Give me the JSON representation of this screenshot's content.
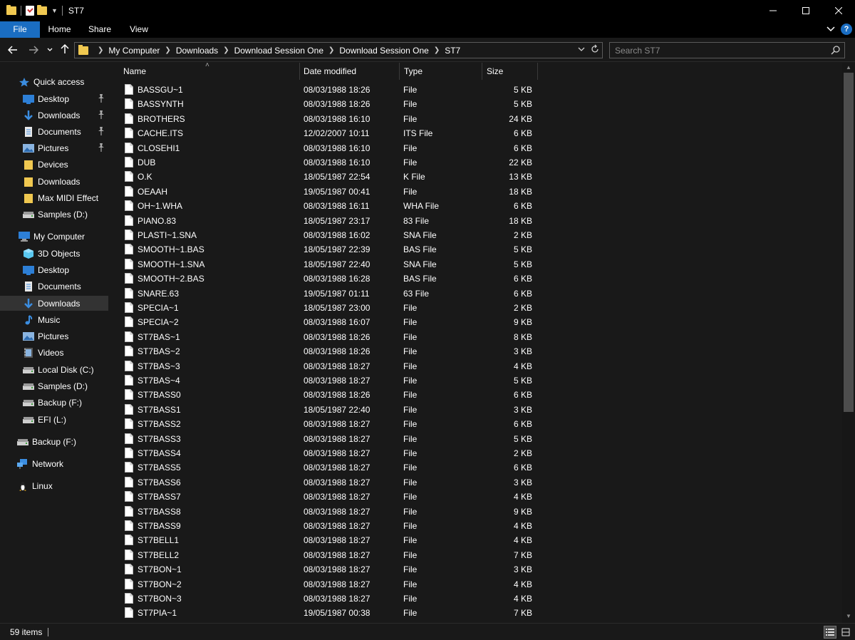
{
  "window": {
    "title": "ST7",
    "minimize_icon": "minimize-icon",
    "maximize_icon": "maximize-icon",
    "close_icon": "close-icon"
  },
  "ribbon": {
    "tabs": [
      {
        "label": "File"
      },
      {
        "label": "Home"
      },
      {
        "label": "Share"
      },
      {
        "label": "View"
      }
    ],
    "help_label": "?"
  },
  "address": {
    "breadcrumbs": [
      "My Computer",
      "Downloads",
      "Download Session One",
      "Download Session One",
      "ST7"
    ]
  },
  "search": {
    "placeholder": "Search ST7"
  },
  "sidebar": {
    "items": [
      {
        "label": "Quick access",
        "icon": "star-icon",
        "pinned": false
      },
      {
        "label": "Desktop",
        "icon": "desktop-icon",
        "pinned": true
      },
      {
        "label": "Downloads",
        "icon": "download-arrow-icon",
        "pinned": true
      },
      {
        "label": "Documents",
        "icon": "documents-icon",
        "pinned": true
      },
      {
        "label": "Pictures",
        "icon": "pictures-icon",
        "pinned": true
      },
      {
        "label": "Devices",
        "icon": "folder-icon",
        "pinned": false
      },
      {
        "label": "Downloads",
        "icon": "folder-icon",
        "pinned": false
      },
      {
        "label": "Max MIDI Effect",
        "icon": "folder-icon",
        "pinned": false
      },
      {
        "label": "Samples (D:)",
        "icon": "drive-icon",
        "pinned": false
      },
      {
        "label": "My Computer",
        "icon": "computer-icon",
        "pinned": false
      },
      {
        "label": "3D Objects",
        "icon": "3d-objects-icon",
        "pinned": false
      },
      {
        "label": "Desktop",
        "icon": "desktop-icon",
        "pinned": false
      },
      {
        "label": "Documents",
        "icon": "documents-icon",
        "pinned": false
      },
      {
        "label": "Downloads",
        "icon": "download-arrow-icon",
        "pinned": false,
        "selected": true
      },
      {
        "label": "Music",
        "icon": "music-icon",
        "pinned": false
      },
      {
        "label": "Pictures",
        "icon": "pictures-icon",
        "pinned": false
      },
      {
        "label": "Videos",
        "icon": "videos-icon",
        "pinned": false
      },
      {
        "label": "Local Disk (C:)",
        "icon": "drive-icon",
        "pinned": false
      },
      {
        "label": "Samples (D:)",
        "icon": "drive-icon",
        "pinned": false
      },
      {
        "label": "Backup (F:)",
        "icon": "drive-icon",
        "pinned": false
      },
      {
        "label": "EFI (L:)",
        "icon": "drive-icon",
        "pinned": false
      },
      {
        "label": "Backup (F:)",
        "icon": "drive-icon",
        "pinned": false
      },
      {
        "label": "Network",
        "icon": "network-icon",
        "pinned": false
      },
      {
        "label": "Linux",
        "icon": "linux-icon",
        "pinned": false
      }
    ]
  },
  "columns": {
    "name": "Name",
    "date": "Date modified",
    "type": "Type",
    "size": "Size"
  },
  "files": [
    {
      "name": "BASSGU~1",
      "date": "08/03/1988 18:26",
      "type": "File",
      "size": "5 KB"
    },
    {
      "name": "BASSYNTH",
      "date": "08/03/1988 18:26",
      "type": "File",
      "size": "5 KB"
    },
    {
      "name": "BROTHERS",
      "date": "08/03/1988 16:10",
      "type": "File",
      "size": "24 KB"
    },
    {
      "name": "CACHE.ITS",
      "date": "12/02/2007 10:11",
      "type": "ITS File",
      "size": "6 KB"
    },
    {
      "name": "CLOSEHI1",
      "date": "08/03/1988 16:10",
      "type": "File",
      "size": "6 KB"
    },
    {
      "name": "DUB",
      "date": "08/03/1988 16:10",
      "type": "File",
      "size": "22 KB"
    },
    {
      "name": "O.K",
      "date": "18/05/1987 22:54",
      "type": "K File",
      "size": "13 KB"
    },
    {
      "name": "OEAAH",
      "date": "19/05/1987 00:41",
      "type": "File",
      "size": "18 KB"
    },
    {
      "name": "OH~1.WHA",
      "date": "08/03/1988 16:11",
      "type": "WHA File",
      "size": "6 KB"
    },
    {
      "name": "PIANO.83",
      "date": "18/05/1987 23:17",
      "type": "83 File",
      "size": "18 KB"
    },
    {
      "name": "PLASTI~1.SNA",
      "date": "08/03/1988 16:02",
      "type": "SNA File",
      "size": "2 KB"
    },
    {
      "name": "SMOOTH~1.BAS",
      "date": "18/05/1987 22:39",
      "type": "BAS File",
      "size": "5 KB"
    },
    {
      "name": "SMOOTH~1.SNA",
      "date": "18/05/1987 22:40",
      "type": "SNA File",
      "size": "5 KB"
    },
    {
      "name": "SMOOTH~2.BAS",
      "date": "08/03/1988 16:28",
      "type": "BAS File",
      "size": "6 KB"
    },
    {
      "name": "SNARE.63",
      "date": "19/05/1987 01:11",
      "type": "63 File",
      "size": "6 KB"
    },
    {
      "name": "SPECIA~1",
      "date": "18/05/1987 23:00",
      "type": "File",
      "size": "2 KB"
    },
    {
      "name": "SPECIA~2",
      "date": "08/03/1988 16:07",
      "type": "File",
      "size": "9 KB"
    },
    {
      "name": "ST7BAS~1",
      "date": "08/03/1988 18:26",
      "type": "File",
      "size": "8 KB"
    },
    {
      "name": "ST7BAS~2",
      "date": "08/03/1988 18:26",
      "type": "File",
      "size": "3 KB"
    },
    {
      "name": "ST7BAS~3",
      "date": "08/03/1988 18:27",
      "type": "File",
      "size": "4 KB"
    },
    {
      "name": "ST7BAS~4",
      "date": "08/03/1988 18:27",
      "type": "File",
      "size": "5 KB"
    },
    {
      "name": "ST7BASS0",
      "date": "08/03/1988 18:26",
      "type": "File",
      "size": "6 KB"
    },
    {
      "name": "ST7BASS1",
      "date": "18/05/1987 22:40",
      "type": "File",
      "size": "3 KB"
    },
    {
      "name": "ST7BASS2",
      "date": "08/03/1988 18:27",
      "type": "File",
      "size": "6 KB"
    },
    {
      "name": "ST7BASS3",
      "date": "08/03/1988 18:27",
      "type": "File",
      "size": "5 KB"
    },
    {
      "name": "ST7BASS4",
      "date": "08/03/1988 18:27",
      "type": "File",
      "size": "2 KB"
    },
    {
      "name": "ST7BASS5",
      "date": "08/03/1988 18:27",
      "type": "File",
      "size": "6 KB"
    },
    {
      "name": "ST7BASS6",
      "date": "08/03/1988 18:27",
      "type": "File",
      "size": "3 KB"
    },
    {
      "name": "ST7BASS7",
      "date": "08/03/1988 18:27",
      "type": "File",
      "size": "4 KB"
    },
    {
      "name": "ST7BASS8",
      "date": "08/03/1988 18:27",
      "type": "File",
      "size": "9 KB"
    },
    {
      "name": "ST7BASS9",
      "date": "08/03/1988 18:27",
      "type": "File",
      "size": "4 KB"
    },
    {
      "name": "ST7BELL1",
      "date": "08/03/1988 18:27",
      "type": "File",
      "size": "4 KB"
    },
    {
      "name": "ST7BELL2",
      "date": "08/03/1988 18:27",
      "type": "File",
      "size": "7 KB"
    },
    {
      "name": "ST7BON~1",
      "date": "08/03/1988 18:27",
      "type": "File",
      "size": "3 KB"
    },
    {
      "name": "ST7BON~2",
      "date": "08/03/1988 18:27",
      "type": "File",
      "size": "4 KB"
    },
    {
      "name": "ST7BON~3",
      "date": "08/03/1988 18:27",
      "type": "File",
      "size": "4 KB"
    },
    {
      "name": "ST7PIA~1",
      "date": "19/05/1987 00:38",
      "type": "File",
      "size": "7 KB"
    }
  ],
  "status": {
    "item_count": "59 items"
  },
  "colors": {
    "accent": "#1a6dc2",
    "background": "#191919",
    "titlebar": "#000000",
    "folder": "#f0c850",
    "selection": "#333333"
  }
}
